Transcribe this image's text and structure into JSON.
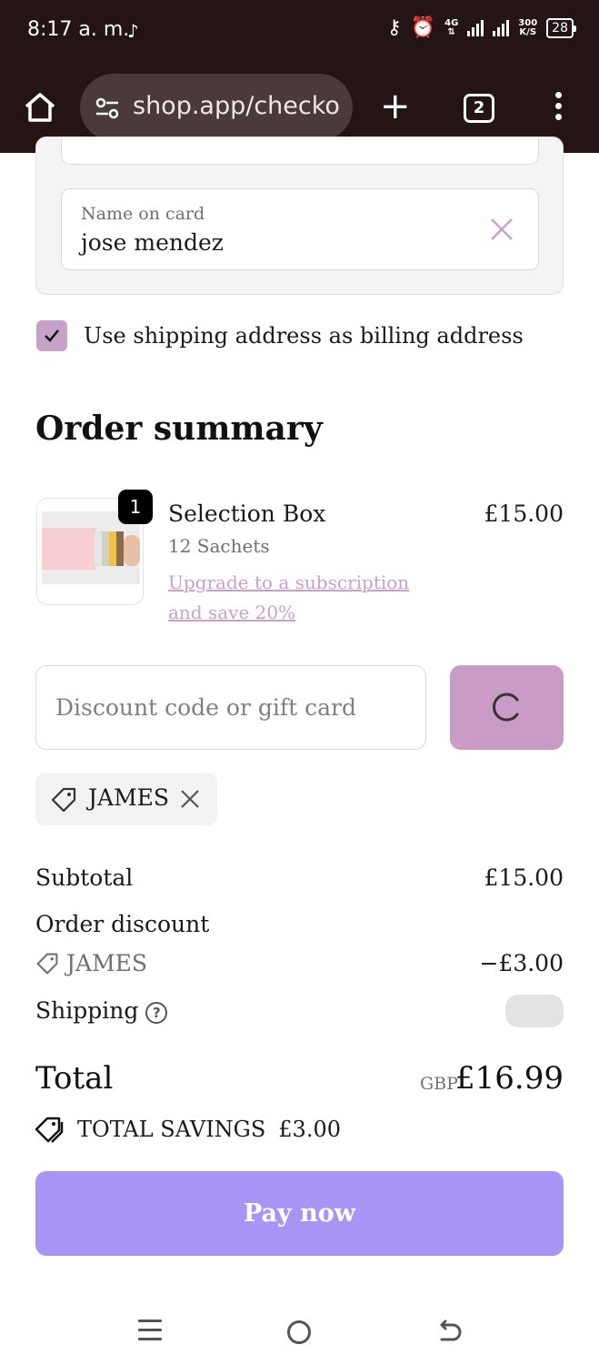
{
  "status_bar": {
    "time": "8:17 a. m.",
    "network": "4G",
    "speed_value": "300",
    "speed_unit": "K/S",
    "battery": "28"
  },
  "browser": {
    "url": "shop.app/checko",
    "tab_count": "2"
  },
  "card_form": {
    "name_label": "Name on card",
    "name_value": "jose mendez"
  },
  "billing": {
    "checked": true,
    "label": "Use shipping address as billing address"
  },
  "order_summary": {
    "title": "Order summary",
    "item": {
      "quantity": "1",
      "name": "Selection Box",
      "variant": "12 Sachets",
      "upgrade_link": "Upgrade to a subscription and save 20%",
      "price": "£15.00"
    }
  },
  "discount": {
    "placeholder": "Discount code or gift card",
    "applied_code": "JAMES"
  },
  "totals": {
    "subtotal_label": "Subtotal",
    "subtotal_value": "£15.00",
    "order_discount_label": "Order discount",
    "discount_code": "JAMES",
    "discount_value": "−£3.00",
    "shipping_label": "Shipping",
    "total_label": "Total",
    "currency": "GBP",
    "total_value": "£16.99",
    "savings_label": "TOTAL SAVINGS",
    "savings_value": "£3.00"
  },
  "pay_button": "Pay now",
  "colors": {
    "accent": "#c7a2c8",
    "pay_button": "#a794f5",
    "status_bar": "#241414"
  },
  "icons": [
    "home-icon",
    "site-settings-icon",
    "plus-icon",
    "tabs-icon",
    "more-vert-icon",
    "clear-icon",
    "check-icon",
    "spinner-icon",
    "tag-icon",
    "help-icon",
    "savings-tag-icon"
  ]
}
